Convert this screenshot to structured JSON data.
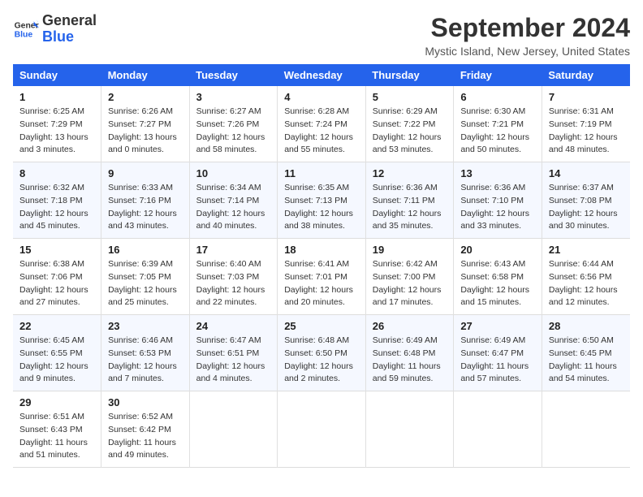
{
  "logo": {
    "general": "General",
    "blue": "Blue"
  },
  "header": {
    "month": "September 2024",
    "location": "Mystic Island, New Jersey, United States"
  },
  "columns": [
    "Sunday",
    "Monday",
    "Tuesday",
    "Wednesday",
    "Thursday",
    "Friday",
    "Saturday"
  ],
  "weeks": [
    [
      {
        "day": "1",
        "sunrise": "Sunrise: 6:25 AM",
        "sunset": "Sunset: 7:29 PM",
        "daylight": "Daylight: 13 hours and 3 minutes."
      },
      {
        "day": "2",
        "sunrise": "Sunrise: 6:26 AM",
        "sunset": "Sunset: 7:27 PM",
        "daylight": "Daylight: 13 hours and 0 minutes."
      },
      {
        "day": "3",
        "sunrise": "Sunrise: 6:27 AM",
        "sunset": "Sunset: 7:26 PM",
        "daylight": "Daylight: 12 hours and 58 minutes."
      },
      {
        "day": "4",
        "sunrise": "Sunrise: 6:28 AM",
        "sunset": "Sunset: 7:24 PM",
        "daylight": "Daylight: 12 hours and 55 minutes."
      },
      {
        "day": "5",
        "sunrise": "Sunrise: 6:29 AM",
        "sunset": "Sunset: 7:22 PM",
        "daylight": "Daylight: 12 hours and 53 minutes."
      },
      {
        "day": "6",
        "sunrise": "Sunrise: 6:30 AM",
        "sunset": "Sunset: 7:21 PM",
        "daylight": "Daylight: 12 hours and 50 minutes."
      },
      {
        "day": "7",
        "sunrise": "Sunrise: 6:31 AM",
        "sunset": "Sunset: 7:19 PM",
        "daylight": "Daylight: 12 hours and 48 minutes."
      }
    ],
    [
      {
        "day": "8",
        "sunrise": "Sunrise: 6:32 AM",
        "sunset": "Sunset: 7:18 PM",
        "daylight": "Daylight: 12 hours and 45 minutes."
      },
      {
        "day": "9",
        "sunrise": "Sunrise: 6:33 AM",
        "sunset": "Sunset: 7:16 PM",
        "daylight": "Daylight: 12 hours and 43 minutes."
      },
      {
        "day": "10",
        "sunrise": "Sunrise: 6:34 AM",
        "sunset": "Sunset: 7:14 PM",
        "daylight": "Daylight: 12 hours and 40 minutes."
      },
      {
        "day": "11",
        "sunrise": "Sunrise: 6:35 AM",
        "sunset": "Sunset: 7:13 PM",
        "daylight": "Daylight: 12 hours and 38 minutes."
      },
      {
        "day": "12",
        "sunrise": "Sunrise: 6:36 AM",
        "sunset": "Sunset: 7:11 PM",
        "daylight": "Daylight: 12 hours and 35 minutes."
      },
      {
        "day": "13",
        "sunrise": "Sunrise: 6:36 AM",
        "sunset": "Sunset: 7:10 PM",
        "daylight": "Daylight: 12 hours and 33 minutes."
      },
      {
        "day": "14",
        "sunrise": "Sunrise: 6:37 AM",
        "sunset": "Sunset: 7:08 PM",
        "daylight": "Daylight: 12 hours and 30 minutes."
      }
    ],
    [
      {
        "day": "15",
        "sunrise": "Sunrise: 6:38 AM",
        "sunset": "Sunset: 7:06 PM",
        "daylight": "Daylight: 12 hours and 27 minutes."
      },
      {
        "day": "16",
        "sunrise": "Sunrise: 6:39 AM",
        "sunset": "Sunset: 7:05 PM",
        "daylight": "Daylight: 12 hours and 25 minutes."
      },
      {
        "day": "17",
        "sunrise": "Sunrise: 6:40 AM",
        "sunset": "Sunset: 7:03 PM",
        "daylight": "Daylight: 12 hours and 22 minutes."
      },
      {
        "day": "18",
        "sunrise": "Sunrise: 6:41 AM",
        "sunset": "Sunset: 7:01 PM",
        "daylight": "Daylight: 12 hours and 20 minutes."
      },
      {
        "day": "19",
        "sunrise": "Sunrise: 6:42 AM",
        "sunset": "Sunset: 7:00 PM",
        "daylight": "Daylight: 12 hours and 17 minutes."
      },
      {
        "day": "20",
        "sunrise": "Sunrise: 6:43 AM",
        "sunset": "Sunset: 6:58 PM",
        "daylight": "Daylight: 12 hours and 15 minutes."
      },
      {
        "day": "21",
        "sunrise": "Sunrise: 6:44 AM",
        "sunset": "Sunset: 6:56 PM",
        "daylight": "Daylight: 12 hours and 12 minutes."
      }
    ],
    [
      {
        "day": "22",
        "sunrise": "Sunrise: 6:45 AM",
        "sunset": "Sunset: 6:55 PM",
        "daylight": "Daylight: 12 hours and 9 minutes."
      },
      {
        "day": "23",
        "sunrise": "Sunrise: 6:46 AM",
        "sunset": "Sunset: 6:53 PM",
        "daylight": "Daylight: 12 hours and 7 minutes."
      },
      {
        "day": "24",
        "sunrise": "Sunrise: 6:47 AM",
        "sunset": "Sunset: 6:51 PM",
        "daylight": "Daylight: 12 hours and 4 minutes."
      },
      {
        "day": "25",
        "sunrise": "Sunrise: 6:48 AM",
        "sunset": "Sunset: 6:50 PM",
        "daylight": "Daylight: 12 hours and 2 minutes."
      },
      {
        "day": "26",
        "sunrise": "Sunrise: 6:49 AM",
        "sunset": "Sunset: 6:48 PM",
        "daylight": "Daylight: 11 hours and 59 minutes."
      },
      {
        "day": "27",
        "sunrise": "Sunrise: 6:49 AM",
        "sunset": "Sunset: 6:47 PM",
        "daylight": "Daylight: 11 hours and 57 minutes."
      },
      {
        "day": "28",
        "sunrise": "Sunrise: 6:50 AM",
        "sunset": "Sunset: 6:45 PM",
        "daylight": "Daylight: 11 hours and 54 minutes."
      }
    ],
    [
      {
        "day": "29",
        "sunrise": "Sunrise: 6:51 AM",
        "sunset": "Sunset: 6:43 PM",
        "daylight": "Daylight: 11 hours and 51 minutes."
      },
      {
        "day": "30",
        "sunrise": "Sunrise: 6:52 AM",
        "sunset": "Sunset: 6:42 PM",
        "daylight": "Daylight: 11 hours and 49 minutes."
      },
      null,
      null,
      null,
      null,
      null
    ]
  ]
}
